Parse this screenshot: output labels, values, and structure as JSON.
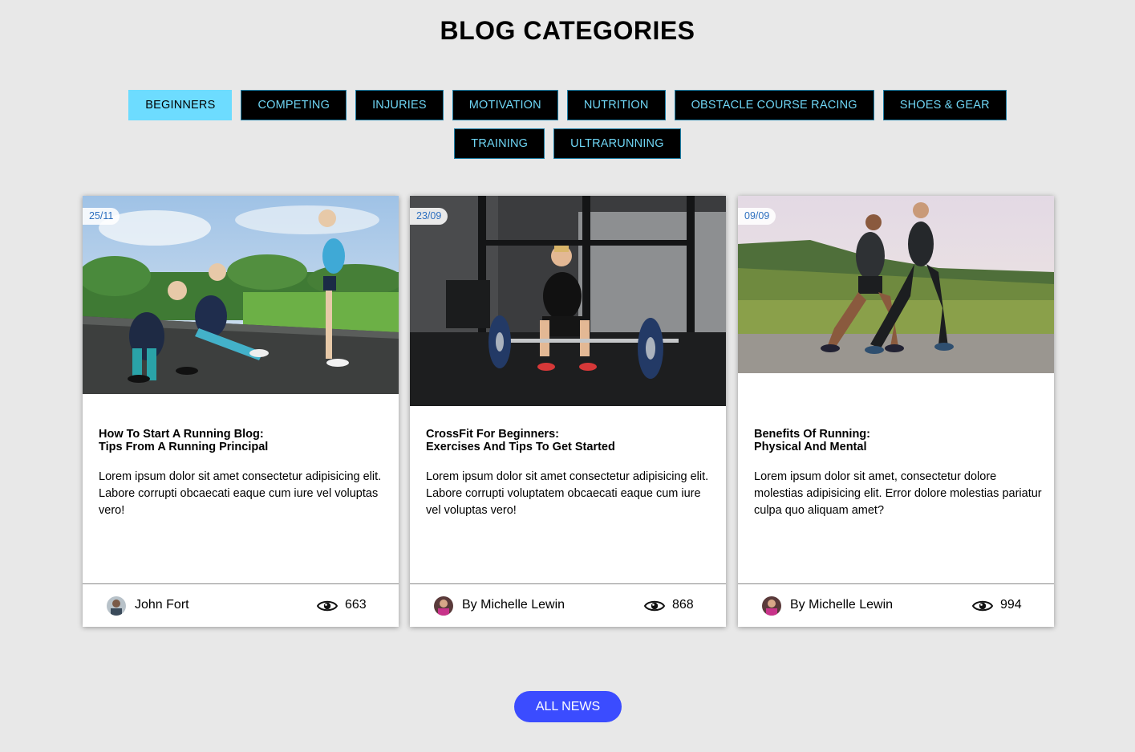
{
  "page": {
    "title": "BLOG CATEGORIES"
  },
  "tabs": [
    {
      "label": "BEGINNERS",
      "active": true
    },
    {
      "label": "COMPETING",
      "active": false
    },
    {
      "label": "INJURIES",
      "active": false
    },
    {
      "label": "MOTIVATION",
      "active": false
    },
    {
      "label": "NUTRITION",
      "active": false
    },
    {
      "label": "OBSTACLE COURSE RACING",
      "active": false
    },
    {
      "label": "SHOES & GEAR",
      "active": false
    },
    {
      "label": "TRAINING",
      "active": false
    },
    {
      "label": "ULTRARUNNING",
      "active": false
    }
  ],
  "cards": [
    {
      "date": "25/11",
      "title_line1": "How To Start A Running Blog:",
      "title_line2": "Tips From A Running Principal",
      "excerpt": "Lorem ipsum dolor sit amet consectetur adipisicing elit. Labore corrupti obcaecati eaque cum iure vel voluptas vero!",
      "author": "John Fort",
      "views": "663",
      "image_icon": "runners-stretching-photo"
    },
    {
      "date": "23/09",
      "title_line1": "CrossFit For Beginners:",
      "title_line2": "Exercises And Tips To Get Started",
      "excerpt": "Lorem ipsum dolor sit amet consectetur adipisicing elit. Labore corrupti voluptatem obcaecati eaque cum iure vel voluptas vero!",
      "author": "By Michelle Lewin",
      "views": "868",
      "image_icon": "crossfit-deadlift-photo"
    },
    {
      "date": "09/09",
      "title_line1": "Benefits Of Running:",
      "title_line2": "Physical And Mental",
      "excerpt": "Lorem ipsum dolor sit amet, consectetur dolore molestias adipisicing elit. Error dolore molestias pariatur culpa quo aliquam amet?",
      "author": "By Michelle Lewin",
      "views": "994",
      "image_icon": "couple-running-photo"
    }
  ],
  "cta": {
    "label": "ALL NEWS"
  },
  "colors": {
    "background": "#e8e8e8",
    "tab_bg": "#000000",
    "tab_text": "#6fd6f5",
    "tab_active_bg": "#6ddcff",
    "date_text": "#2d6fbf",
    "cta_bg": "#3b4cff"
  }
}
